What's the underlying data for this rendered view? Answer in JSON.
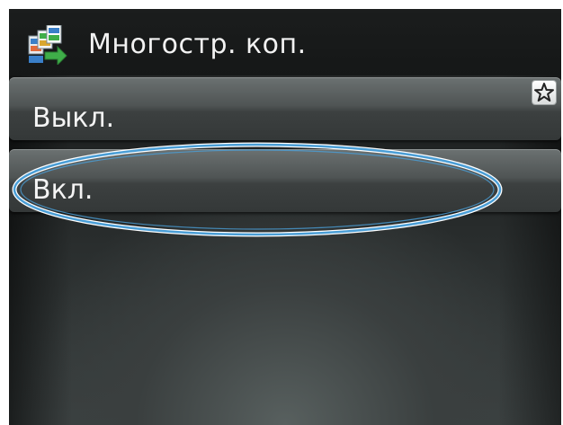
{
  "header": {
    "title": "Многостр. коп.",
    "icon": "multi-page-copy-icon"
  },
  "options": [
    {
      "label": "Выкл.",
      "selected": false
    },
    {
      "label": "Вкл.",
      "selected": true
    }
  ],
  "favorite": {
    "icon": "star-icon"
  },
  "colors": {
    "background": "#202323",
    "header": "#171919",
    "button": "#4f5454",
    "text": "#f4f4f4",
    "highlight": "#4a9ed6",
    "icon_green": "#3fae49",
    "icon_blue": "#3a7fc8"
  }
}
